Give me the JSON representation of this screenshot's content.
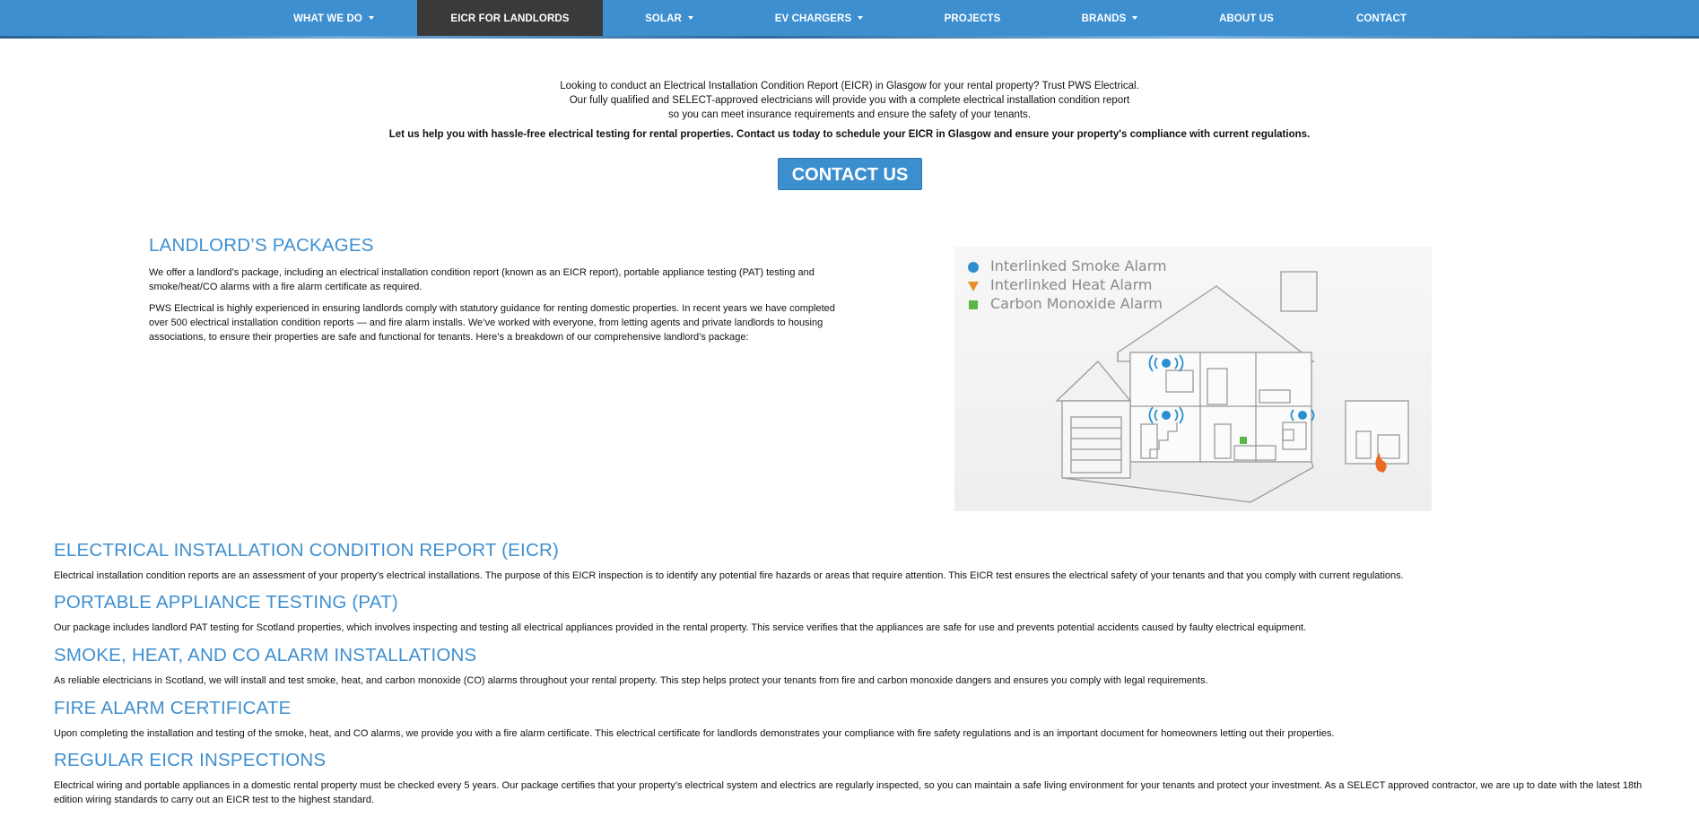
{
  "nav": {
    "items": [
      {
        "label": "WHAT WE DO",
        "dropdown": true
      },
      {
        "label": "EICR FOR LANDLORDS",
        "dropdown": false,
        "active": true
      },
      {
        "label": "SOLAR",
        "dropdown": true
      },
      {
        "label": "EV CHARGERS",
        "dropdown": true
      },
      {
        "label": "PROJECTS",
        "dropdown": false
      },
      {
        "label": "BRANDS",
        "dropdown": true
      },
      {
        "label": "ABOUT US",
        "dropdown": false
      },
      {
        "label": "CONTACT",
        "dropdown": false
      }
    ]
  },
  "intro": {
    "line1": "Looking to conduct an Electrical Installation Condition Report (EICR) in Glasgow for your rental property? Trust PWS Electrical.",
    "line2": "Our fully qualified and SELECT-approved electricians will provide you with a complete electrical installation condition report",
    "line3": "so you can meet insurance requirements and ensure the safety of your tenants.",
    "bold": "Let us help you with hassle-free electrical testing for rental properties. Contact us today to schedule your EICR in Glasgow and ensure your property's compliance with current regulations.",
    "cta": "CONTACT US"
  },
  "packages": {
    "heading": "LANDLORD’S PACKAGES",
    "para1": "We offer a landlord’s package, including an electrical installation condition report (known as an EICR report), portable appliance testing (PAT) testing and smoke/heat/CO alarms with a fire alarm certificate as required.",
    "para2": "PWS Electrical is highly experienced in ensuring landlords comply with statutory guidance for renting domestic properties. In recent years we have completed over 500 electrical installation condition reports — and fire alarm installs. We’ve worked with everyone, from letting agents and private landlords to housing associations, to ensure their properties are safe and functional for tenants. Here’s a breakdown of our comprehensive landlord’s package:"
  },
  "illustration": {
    "legend": [
      {
        "label": "Interlinked Smoke Alarm",
        "color": "#2a8fd0",
        "icon": "circle"
      },
      {
        "label": "Interlinked Heat Alarm",
        "color": "#e88c2e",
        "icon": "triangle"
      },
      {
        "label": "Carbon Monoxide Alarm",
        "color": "#5bb544",
        "icon": "square"
      }
    ]
  },
  "sections": [
    {
      "heading": "ELECTRICAL INSTALLATION CONDITION REPORT (EICR)",
      "text": "Electrical installation condition reports are an assessment of your property’s electrical installations. The purpose of this EICR inspection is to identify any potential fire hazards or areas that require attention. This EICR test ensures the electrical safety of your tenants and that you comply with current regulations."
    },
    {
      "heading": "PORTABLE APPLIANCE TESTING (PAT)",
      "text": "Our package includes landlord PAT testing for Scotland properties,  which involves inspecting and testing all electrical appliances provided in the rental property. This service verifies that the appliances are safe for use and prevents potential accidents caused by faulty electrical equipment."
    },
    {
      "heading": "SMOKE, HEAT, AND CO ALARM INSTALLATIONS",
      "text": "As reliable electricians in Scotland, we will install and test smoke, heat, and carbon monoxide (CO) alarms throughout your rental property. This step helps protect your tenants from fire and carbon monoxide dangers and ensures you comply with legal requirements."
    },
    {
      "heading": "FIRE ALARM CERTIFICATE",
      "text": "Upon completing the installation and testing of the smoke, heat, and CO alarms, we provide you with a fire alarm certificate. This electrical certificate for landlords demonstrates your compliance with fire safety regulations and is an important document for homeowners letting out their properties."
    },
    {
      "heading": "REGULAR EICR INSPECTIONS",
      "text": "Electrical wiring and portable appliances in a domestic rental property must be checked every 5 years. Our package certifies that your property’s electrical system and electrics are regularly inspected, so you can maintain a safe living environment for your tenants and protect your investment. As a SELECT approved contractor, we are up to date with the latest 18th edition wiring standards to carry out an EICR test to the highest standard."
    }
  ]
}
